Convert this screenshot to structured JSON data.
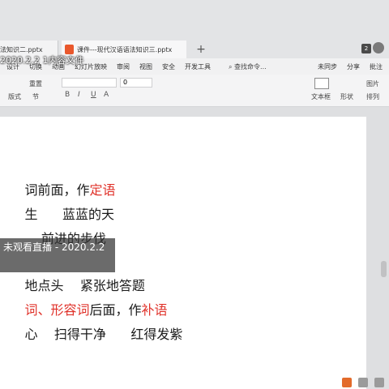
{
  "tabs": {
    "tab1_label": "法知识二.pptx",
    "tab2_label": "课件---现代汉语语法知识三.pptx",
    "add_label": "+",
    "window_badge": "2"
  },
  "overlay": {
    "date_label": "2020.2.2  1内容文件",
    "live_label": "未观看直播 - 2020.2.2"
  },
  "menu": {
    "items": [
      "设计",
      "切换",
      "动画",
      "幻灯片放映",
      "审阅",
      "视图",
      "安全",
      "开发工具"
    ],
    "search_label": "查找命令...",
    "sync_label": "未同步",
    "share_label": "分享",
    "comment_label": "批注"
  },
  "ribbon": {
    "reset_label": "重置",
    "layout_label": "版式",
    "section_label": "节",
    "font_size_value": "0",
    "textbox_label": "文本框",
    "shape_label": "形状",
    "arrange_label": "排列",
    "picture_label": "图片"
  },
  "slide": {
    "lines": [
      {
        "parts": [
          {
            "text": "词前面，作",
            "red": false
          },
          {
            "text": "定语",
            "red": true
          }
        ]
      },
      {
        "parts": [
          {
            "text": "生      蓝蓝的天",
            "red": false
          }
        ]
      },
      {
        "parts": [
          {
            "text": "    前进的步伐",
            "red": false
          }
        ]
      },
      {
        "parts": [
          {
            "text": "地点头    紧张地答题",
            "red": false
          }
        ]
      },
      {
        "parts": [
          {
            "text": "词、形容词",
            "red": true
          },
          {
            "text": "后面，作",
            "red": false
          },
          {
            "text": "补语",
            "red": true
          }
        ]
      },
      {
        "parts": [
          {
            "text": "心    扫得干净      红得发紫",
            "red": false
          }
        ]
      }
    ]
  }
}
